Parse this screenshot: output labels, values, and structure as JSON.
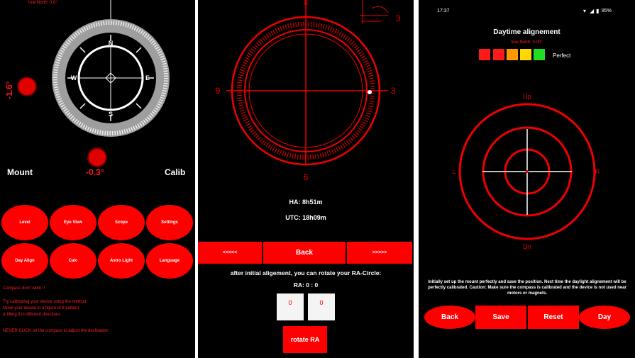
{
  "panel1": {
    "top_text": "true North: 0.0°",
    "compass_north": "N",
    "compass_east": "E",
    "compass_south": "S",
    "compass_west": "W",
    "tilt_left": "-1.6°",
    "tilt_bottom": "-0.3°",
    "mount_label": "Mount",
    "calib_label": "Calib",
    "buttons": [
      {
        "label": "Level"
      },
      {
        "label": "Eye View"
      },
      {
        "label": "Scope"
      },
      {
        "label": "Settings"
      },
      {
        "label": "Day Align"
      },
      {
        "label": "Calc"
      },
      {
        "label": "Astro Light"
      },
      {
        "label": "Language"
      }
    ],
    "compass_status": "Compass don't work !!",
    "instructions": [
      "Try calibrating your device using the method",
      "Move your device in a figure of 8 pattern",
      "& tilting it in different directions"
    ],
    "tap_hint": "NEVER CLICK on the compass to adjust the declination"
  },
  "panel2": {
    "dial_top": "0",
    "dial_right": "3",
    "dial_bottom": "6",
    "dial_left": "9",
    "corner_num": "3",
    "ha_text": "HA: 8h51m",
    "utc_text": "UTC: 18h09m",
    "bar_left": "<<<<<",
    "bar_center": "Back",
    "bar_right": ">>>>>",
    "info_text": "after initial aligement, you can rotate your RA-Circle:",
    "ra_text": "RA: 0 : 0",
    "field1": "0",
    "field2": "0",
    "rotate_label": "rotate RA"
  },
  "panel3": {
    "status_time": "17:37",
    "status_battery": "85%",
    "title": "Daytime alignement",
    "true_north": "true North: 0.00°",
    "perfect_label": "Perfect",
    "quality_colors": [
      "#ff1a1a",
      "#ff1a1a",
      "#ff9900",
      "#ffd800",
      "#22dd22"
    ],
    "up": "Up",
    "down": "Dn",
    "left": "L",
    "right": "R",
    "instructions": "Initially set up the mount perfectly and save the position. Next time the daylight alignement will be perfectly calibrated. Caution: Make sure the compass is calibrated and the device is not used near motors or magnets.",
    "btn_back": "Back",
    "btn_save": "Save",
    "btn_reset": "Reset",
    "btn_day": "Day"
  }
}
